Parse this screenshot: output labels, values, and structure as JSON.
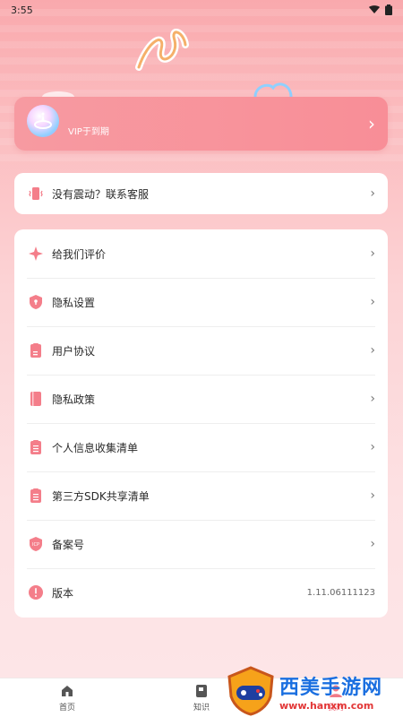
{
  "status_bar": {
    "time": "3:55"
  },
  "vip": {
    "label": "VIP于到期"
  },
  "support": {
    "label": "没有震动？联系客服"
  },
  "menu": {
    "items": [
      {
        "label": "给我们评价",
        "icon": "star-sparkle-icon"
      },
      {
        "label": "隐私设置",
        "icon": "shield-lock-icon"
      },
      {
        "label": "用户协议",
        "icon": "document-icon"
      },
      {
        "label": "隐私政策",
        "icon": "book-icon"
      },
      {
        "label": "个人信息收集清单",
        "icon": "clipboard-list-icon"
      },
      {
        "label": "第三方SDK共享清单",
        "icon": "clipboard-list-icon"
      },
      {
        "label": "备案号",
        "icon": "icp-shield-icon"
      },
      {
        "label": "版本",
        "icon": "info-icon",
        "value": "1.11.06111123"
      }
    ]
  },
  "nav": {
    "items": [
      {
        "label": "首页",
        "icon": "home-icon"
      },
      {
        "label": "知识",
        "icon": "book-icon"
      },
      {
        "label": "我的",
        "icon": "user-icon"
      }
    ]
  },
  "watermark": {
    "title": "西美手游网",
    "url": "www.hanxm.com"
  },
  "colors": {
    "accent": "#f88e97",
    "icon_pink": "#f47e8a"
  }
}
